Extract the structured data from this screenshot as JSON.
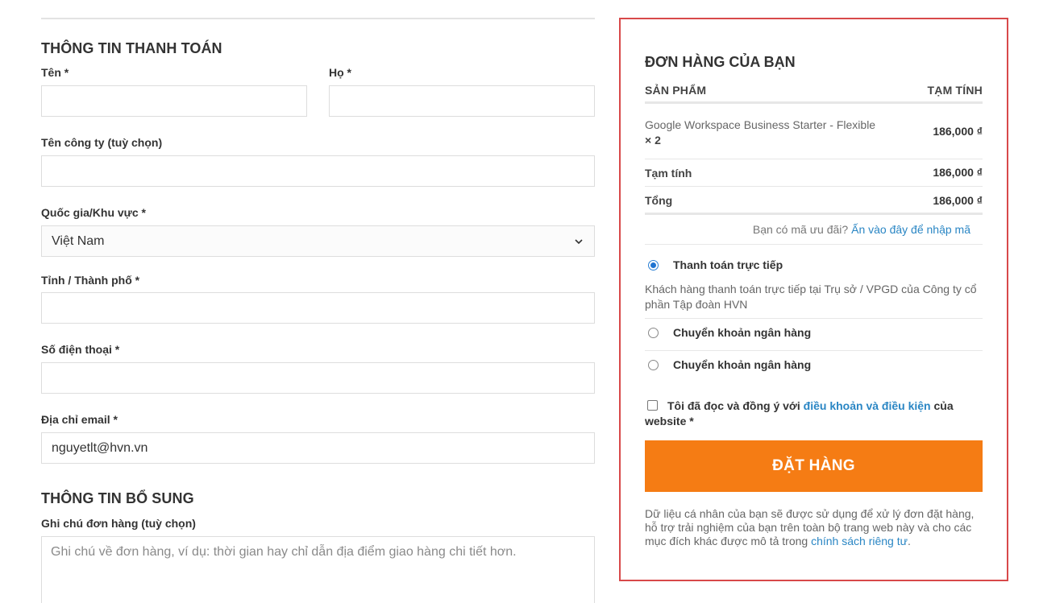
{
  "billing": {
    "title": "THÔNG TIN THANH TOÁN",
    "first_name": {
      "label": "Tên *",
      "value": ""
    },
    "last_name": {
      "label": "Họ *",
      "value": ""
    },
    "company": {
      "label": "Tên công ty (tuỳ chọn)",
      "value": ""
    },
    "country": {
      "label": "Quốc gia/Khu vực *",
      "selected": "Việt Nam"
    },
    "city": {
      "label": "Tỉnh / Thành phố *",
      "value": ""
    },
    "phone": {
      "label": "Số điện thoại *",
      "value": ""
    },
    "email": {
      "label": "Địa chỉ email *",
      "value": "nguyetlt@hvn.vn"
    }
  },
  "additional": {
    "title": "THÔNG TIN BỔ SUNG",
    "notes": {
      "label": "Ghi chú đơn hàng (tuỳ chọn)",
      "placeholder": "Ghi chú về đơn hàng, ví dụ: thời gian hay chỉ dẫn địa điểm giao hàng chi tiết hơn."
    }
  },
  "order": {
    "title": "ĐƠN HÀNG CỦA BẠN",
    "col_product": "SẢN PHẨM",
    "col_subtotal": "TẠM TÍNH",
    "item": {
      "name": "Google Workspace Business Starter - Flexible",
      "qty": "× 2",
      "price": "186,000 ₫"
    },
    "subtotal_label": "Tạm tính",
    "subtotal_value": "186,000 ₫",
    "total_label": "Tổng",
    "total_value": "186,000 ₫",
    "coupon_text": "Bạn có mã ưu đãi?",
    "coupon_link": "Ấn vào đây để nhập mã",
    "payment_methods": [
      {
        "label": "Thanh toán trực tiếp",
        "checked": true
      },
      {
        "label": "Chuyển khoản ngân hàng",
        "checked": false
      },
      {
        "label": "Chuyển khoản ngân hàng",
        "checked": false
      }
    ],
    "payment_desc": "Khách hàng thanh toán trực tiếp tại Trụ sở / VPGD của Công ty cổ phần Tập đoàn HVN",
    "terms_prefix": "Tôi đã đọc và đồng ý với",
    "terms_link": "điều khoản và điều kiện",
    "terms_suffix": "của website *",
    "place_order": "ĐẶT HÀNG",
    "privacy_text": "Dữ liệu cá nhân của bạn sẽ được sử dụng để xử lý đơn đặt hàng, hỗ trợ trải nghiệm của bạn trên toàn bộ trang web này và cho các mục đích khác được mô tả trong",
    "privacy_link": "chính sách riêng tư",
    "privacy_end": "."
  },
  "colors": {
    "button": "#f57c14",
    "box_border": "#d8494a",
    "link": "#2a86c4"
  }
}
